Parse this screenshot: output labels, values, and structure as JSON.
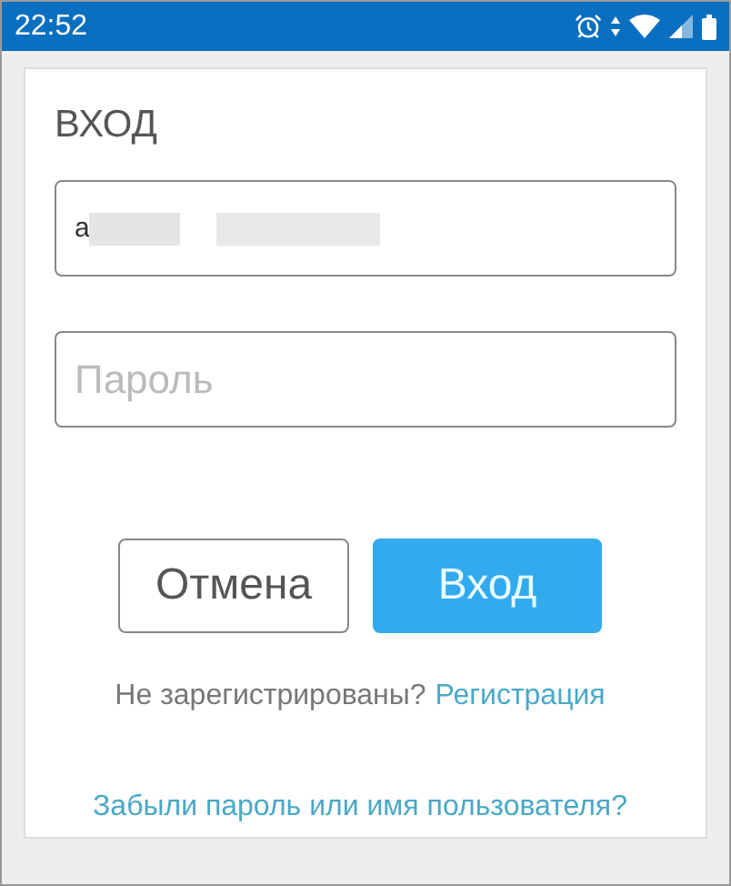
{
  "status_bar": {
    "time": "22:52"
  },
  "login": {
    "title": "ВХОД",
    "username": {
      "value": "a"
    },
    "password": {
      "placeholder": "Пароль"
    },
    "buttons": [
      {
        "label": "Отмена",
        "kind": "secondary"
      },
      {
        "label": "Вход",
        "kind": "primary"
      }
    ],
    "register_prompt": "Не зарегистрированы?",
    "register_link": "Регистрация",
    "forgot_link": "Забыли пароль или имя пользователя?"
  }
}
